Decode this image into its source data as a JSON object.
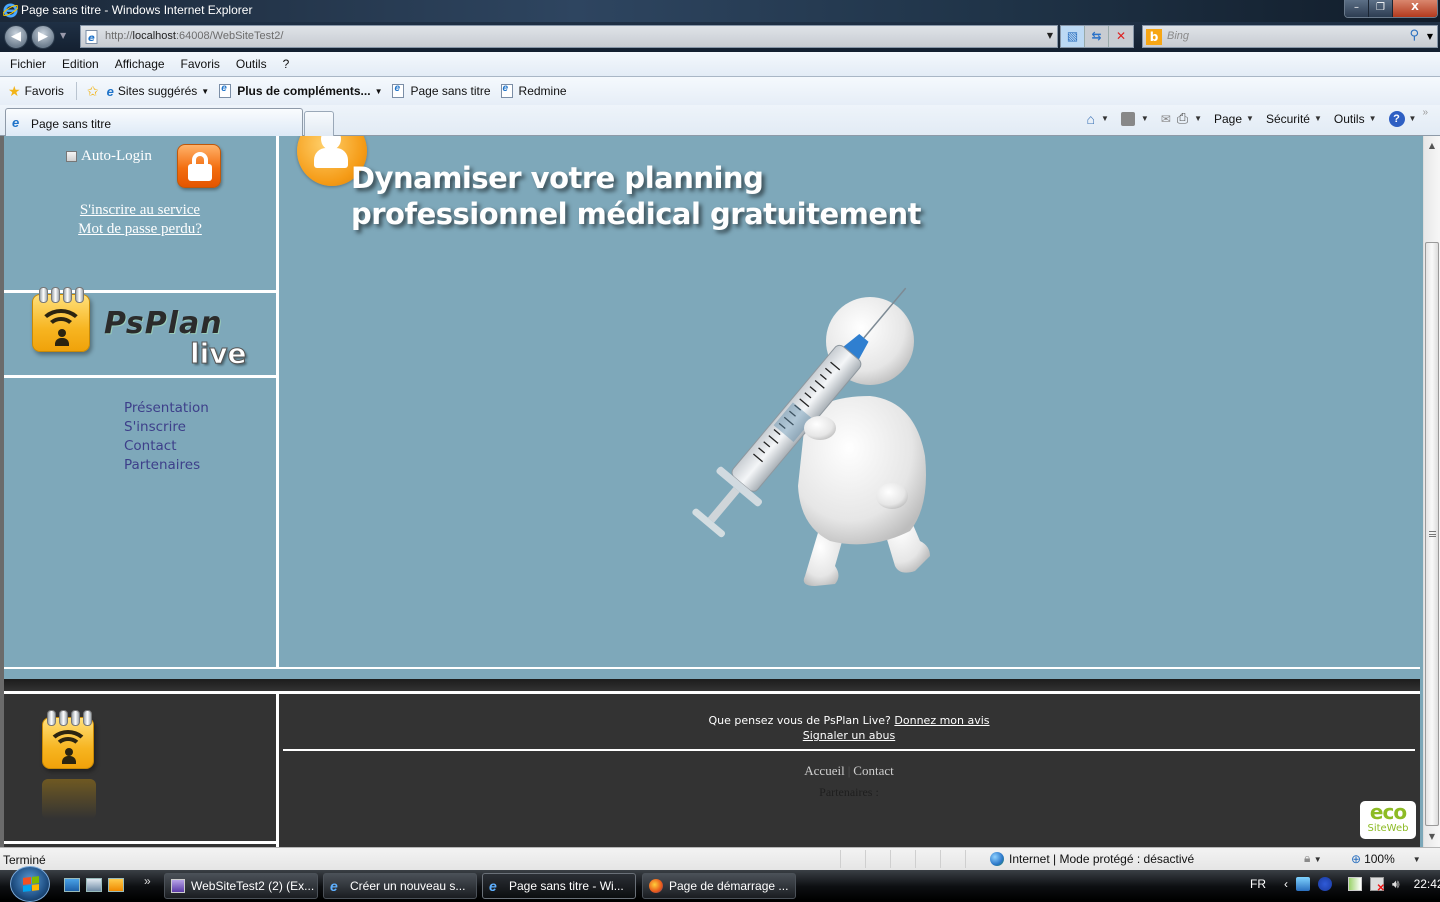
{
  "window": {
    "title": "Page sans titre - Windows Internet Explorer",
    "controls": {
      "minimize": "–",
      "restore": "❐",
      "close": "X"
    }
  },
  "address_bar": {
    "url_prefix": "http://",
    "url_host": "localhost",
    "url_rest": ":64008/WebSiteTest2/",
    "search_placeholder": "Bing",
    "icons": [
      "back-icon",
      "forward-icon",
      "compat-view-icon",
      "refresh-icon",
      "stop-icon",
      "search-icon"
    ]
  },
  "menu_bar": {
    "items": [
      "Fichier",
      "Edition",
      "Affichage",
      "Favoris",
      "Outils",
      "?"
    ]
  },
  "favorites_bar": {
    "favorites_label": "Favoris",
    "items": [
      {
        "label": "Sites suggérés",
        "has_dropdown": true
      },
      {
        "label": "Plus de compléments...",
        "has_dropdown": true,
        "bold": true
      },
      {
        "label": "Page sans titre",
        "has_dropdown": false
      },
      {
        "label": "Redmine",
        "has_dropdown": false
      }
    ]
  },
  "tabs": {
    "active_tab": "Page sans titre"
  },
  "command_bar": {
    "page": "Page",
    "security": "Sécurité",
    "tools": "Outils",
    "help": "?"
  },
  "page": {
    "login": {
      "auto_login_label": "Auto-Login",
      "auto_login_checked": false,
      "register_link": "S'inscrire au service",
      "lost_password_link": "Mot de passe perdu?"
    },
    "brand": {
      "name": "PsPlan",
      "sub": "live"
    },
    "nav": [
      "Présentation",
      "S'inscrire",
      "Contact",
      "Partenaires"
    ],
    "hero": {
      "title_line1": "Dynamiser votre planning",
      "title_line2": "professionnel médical gratuitement",
      "illustration": "3D figure holding a syringe"
    },
    "footer": {
      "feedback_text": "Que pensez vous de PsPlan Live?",
      "feedback_link": "Donnez mon avis",
      "report_link": "Signaler un abus",
      "links": [
        "Accueil",
        "Contact"
      ],
      "partners_label": "Partenaires :",
      "eco_badge_top": "eco",
      "eco_badge_bottom": "SiteWeb"
    }
  },
  "status_bar": {
    "status": "Terminé",
    "zone": "Internet | Mode protégé : désactivé",
    "zoom": "100%"
  },
  "taskbar": {
    "tasks": [
      {
        "label": "WebSiteTest2 (2) (Ex...",
        "icon": "visual-studio-icon",
        "active": false
      },
      {
        "label": "Créer un nouveau s...",
        "icon": "ie-icon",
        "active": false
      },
      {
        "label": "Page sans titre - Wi...",
        "icon": "ie-icon",
        "active": true
      },
      {
        "label": "Page de démarrage ...",
        "icon": "firefox-icon",
        "active": false
      }
    ],
    "language": "FR",
    "clock": "22:42"
  },
  "colors": {
    "page_background": "#7ea8ba",
    "footer_background": "#333333",
    "nav_link": "#3d3f8a",
    "accent_orange": "#f36e10",
    "eco_green": "#8dbb25"
  }
}
